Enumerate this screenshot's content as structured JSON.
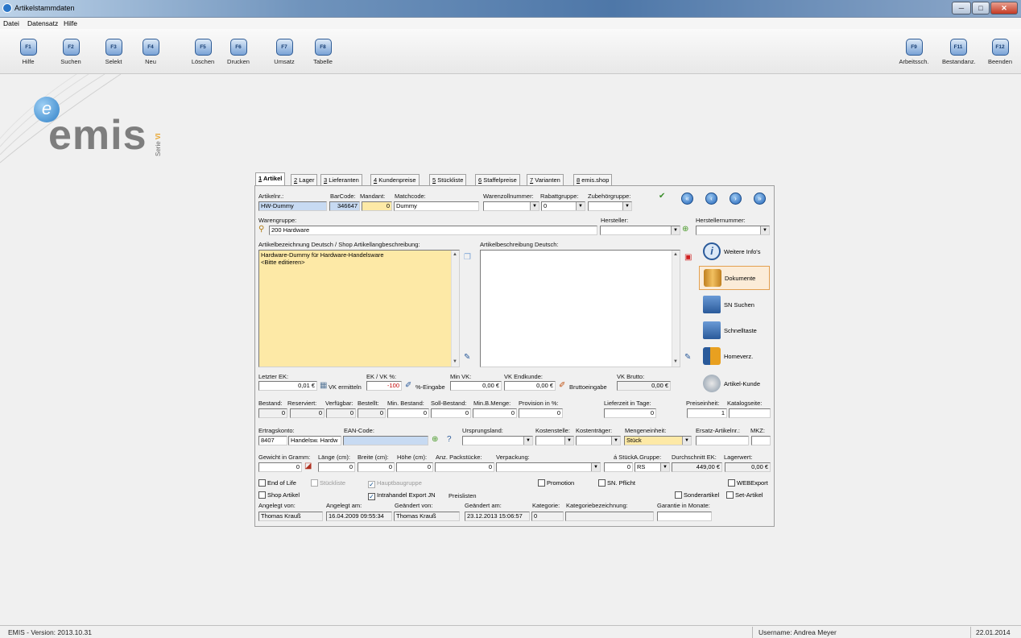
{
  "window": {
    "title": "Artikelstammdaten",
    "min": "─",
    "max": "□",
    "close": "✕"
  },
  "menu": [
    "Datei",
    "Datensatz",
    "Hilfe"
  ],
  "toolbar_left": [
    {
      "key": "F1",
      "label": "Hilfe"
    },
    {
      "key": "F2",
      "label": "Suchen"
    },
    {
      "key": "F3",
      "label": "Selekt"
    },
    {
      "key": "F4",
      "label": "Neu"
    },
    {
      "key": "F5",
      "label": "Löschen"
    },
    {
      "key": "F6",
      "label": "Drucken"
    },
    {
      "key": "F7",
      "label": "Umsatz"
    },
    {
      "key": "F8",
      "label": "Tabelle"
    }
  ],
  "toolbar_right": [
    {
      "key": "F9",
      "label": "Arbeitssch."
    },
    {
      "key": "F11",
      "label": "Bestandanz."
    },
    {
      "key": "F12",
      "label": "Beenden"
    }
  ],
  "logo": {
    "letter": "e",
    "word": "emis",
    "serie": "Serie",
    "version": "VI"
  },
  "tabs": [
    {
      "num": "1",
      "label": "Artikel"
    },
    {
      "num": "2",
      "label": "Lager"
    },
    {
      "num": "3",
      "label": "Lieferanten"
    },
    {
      "num": "4",
      "label": "Kundenpreise"
    },
    {
      "num": "5",
      "label": "Stückliste"
    },
    {
      "num": "6",
      "label": "Staffelpreise"
    },
    {
      "num": "7",
      "label": "Varianten"
    },
    {
      "num": "8",
      "label": "emis.shop"
    }
  ],
  "form": {
    "artikelnr_label": "Artikelnr.:",
    "artikelnr": "HW-Dummy",
    "barcode_label": "BarCode:",
    "barcode": "346647",
    "mandant_label": "Mandant:",
    "mandant": "0",
    "matchcode_label": "Matchcode:",
    "matchcode": "Dummy",
    "warenzoll_label": "Warenzollnummer:",
    "warenzoll": "",
    "rabatt_label": "Rabattgruppe:",
    "rabatt": "0",
    "zubehoer_label": "Zubehörgruppe:",
    "zubehoer": "",
    "warengruppe_label": "Warengruppe:",
    "warengruppe": "200 Hardware",
    "hersteller_label": "Hersteller:",
    "hersteller": "",
    "herstellernr_label": "Herstellernummer:",
    "herstellernr": "",
    "bez_label": "Artikelbezeichnung Deutsch / Shop Artikellangbeschreibung:",
    "bez_line1": "Hardware-Dummy für Hardware-Handelsware",
    "bez_line2": "<Bitte editieren>",
    "beschr_label": "Artikelbeschreibung Deutsch:",
    "letzter_ek_label": "Letzter EK:",
    "letzter_ek": "0,01 €",
    "ekvk_label": "EK / VK %:",
    "ekvk": "-100",
    "vk_ermitteln": "VK ermitteln",
    "pct_eingabe": "%-Eingabe",
    "min_vk_label": "Min VK:",
    "min_vk": "0,00 €",
    "vk_endkunde_label": "VK Endkunde:",
    "vk_endkunde": "0,00 €",
    "brutto_eingabe": "Bruttoeingabe",
    "vk_brutto_label": "VK Brutto:",
    "vk_brutto": "0,00 €",
    "bestand_label": "Bestand:",
    "bestand": "0",
    "reserviert_label": "Reserviert:",
    "reserviert": "0",
    "verfuegbar_label": "Verfügbar:",
    "verfuegbar": "0",
    "bestellt_label": "Bestellt:",
    "bestellt": "0",
    "min_bestand_label": "Min. Bestand:",
    "min_bestand": "0",
    "soll_bestand_label": "Soll-Bestand:",
    "soll_bestand": "0",
    "min_b_menge_label": "Min.B.Menge:",
    "min_b_menge": "0",
    "provision_label": "Provision in %:",
    "provision": "0",
    "lieferzeit_label": "Lieferzeit in Tage:",
    "lieferzeit": "0",
    "preiseinheit_label": "Preiseinheit:",
    "preiseinheit": "1",
    "katalogseite_label": "Katalogseite:",
    "katalogseite": "",
    "ertragskonto_label": "Ertragskonto:",
    "ertragskonto": "8407",
    "ertragskonto_name": "Handelsw. Hardw",
    "ean_label": "EAN-Code:",
    "ean": "",
    "ursprung_label": "Ursprungsland:",
    "ursprung": "",
    "kostenstelle_label": "Kostenstelle:",
    "kostenstelle": "",
    "kostentraeger_label": "Kostenträger:",
    "kostentraeger": "",
    "mengeneinheit_label": "Mengeneinheit:",
    "mengeneinheit": "Stück",
    "ersatz_label": "Ersatz-Artikelnr.:",
    "ersatz": "",
    "mkz_label": "MKZ:",
    "mkz": "",
    "gewicht_label": "Gewicht in Gramm:",
    "gewicht": "0",
    "laenge_label": "Länge (cm):",
    "laenge": "0",
    "breite_label": "Breite (cm):",
    "breite": "0",
    "hoehe_label": "Höhe (cm):",
    "hoehe": "0",
    "packstuecke_label": "Anz. Packstücke:",
    "packstuecke": "0",
    "verpackung_label": "Verpackung:",
    "verpackung": "",
    "a_stueck_label": "á Stück:",
    "a_stueck": "0",
    "a_gruppe_label": "A.Gruppe:",
    "a_gruppe": "RS",
    "durchschnitt_label": "Durchschnitt EK:",
    "durchschnitt": "449,00 €",
    "lagerwert_label": "Lagerwert:",
    "lagerwert": "0,00 €",
    "angelegt_von_label": "Angelegt von:",
    "angelegt_von": "Thomas Krauß",
    "angelegt_am_label": "Angelegt am:",
    "angelegt_am": "16.04.2009 09:55:34",
    "geaendert_von_label": "Geändert von:",
    "geaendert_von": "Thomas Krauß",
    "geaendert_am_label": "Geändert am:",
    "geaendert_am": "23.12.2013 15:06:57",
    "kategorie_label": "Kategorie:",
    "kategorie": "0",
    "kategoriebez_label": "Kategoriebezeichnung:",
    "kategoriebez": "",
    "garantie_label": "Garantie in Monate:",
    "garantie": "",
    "preislisten": "Preislisten"
  },
  "checkboxes": {
    "end_of_life": {
      "label": "End of Life",
      "checked": false
    },
    "stueckliste": {
      "label": "Stückliste",
      "checked": false
    },
    "hauptbaugruppe": {
      "label": "Hauptbaugruppe",
      "checked": true
    },
    "promotion": {
      "label": "Promotion",
      "checked": false
    },
    "sn_pflicht": {
      "label": "SN. Pflicht",
      "checked": false
    },
    "webexport": {
      "label": "WEBExport",
      "checked": false
    },
    "shop_artikel": {
      "label": "Shop Artikel",
      "checked": false
    },
    "intrahandel": {
      "label": "Intrahandel Export JN",
      "checked": true
    },
    "sonderartikel": {
      "label": "Sonderartikel",
      "checked": false
    },
    "set_artikel": {
      "label": "Set-Artikel",
      "checked": false
    }
  },
  "side_buttons": [
    "Weitere Info's",
    "Dokumente",
    "SN Suchen",
    "Schnelltaste",
    "Homeverz.",
    "Artikel-Kunde"
  ],
  "status": {
    "version": "EMIS - Version: 2013.10.31",
    "user": "Username: Andrea Meyer",
    "date": "22.01.2014"
  },
  "colors": {
    "blue_field": "#c7daf2",
    "yellow_field": "#fde9a6",
    "highlight": "#e3a050"
  }
}
